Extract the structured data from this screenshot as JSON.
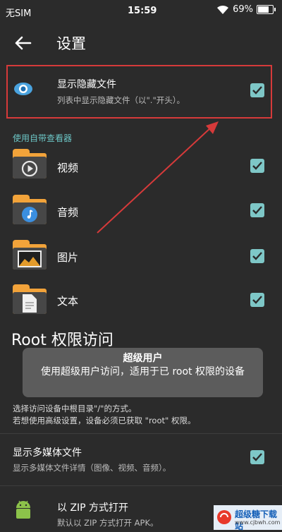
{
  "status_bar": {
    "carrier": "无SIM",
    "time": "15:59",
    "battery": "69%"
  },
  "header": {
    "title": "设置"
  },
  "show_hidden": {
    "title": "显示隐藏文件",
    "subtitle": "列表中显示隐藏文件（以\".\"开头）。",
    "checked": true
  },
  "viewer_section": {
    "title": "使用自带查看器"
  },
  "viewer_items": [
    {
      "label": "视频",
      "icon": "video-play-icon",
      "checked": true
    },
    {
      "label": "音频",
      "icon": "music-note-icon",
      "checked": true
    },
    {
      "label": "图片",
      "icon": "picture-icon",
      "checked": true
    },
    {
      "label": "文本",
      "icon": "document-icon",
      "checked": true
    }
  ],
  "root_section": {
    "title": "Root 权限访问"
  },
  "toast": {
    "title": "超级用户",
    "message": "使用超级用户访问，适用于已 root 权限的设备"
  },
  "root_description": [
    "选择访问设备中根目录\"/\"的方式。",
    "若想使用高级设置，设备必须已获取 \"root\" 权限。"
  ],
  "show_media": {
    "title": "显示多媒体文件",
    "subtitle": "显示多媒体文件详情（图像、视频、音频）。",
    "checked": true
  },
  "zip_open": {
    "title": "以 ZIP 方式打开",
    "subtitle": "默认以 ZIP 方式打开 APK。"
  },
  "watermark": {
    "name": "超级糖下载站",
    "url": "www.cjbwh.com"
  },
  "colors": {
    "accent": "#7ec7c7",
    "highlight": "#d63a3a",
    "folder": "#f2a33a",
    "background": "#2b2b2b"
  }
}
